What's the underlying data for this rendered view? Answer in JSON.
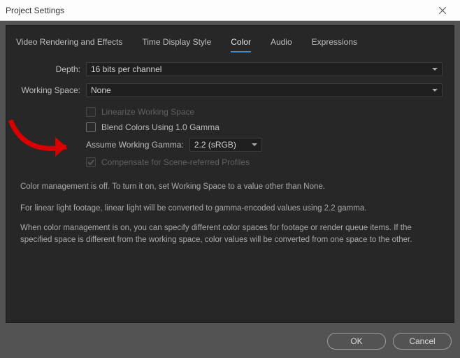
{
  "window": {
    "title": "Project Settings"
  },
  "tabs": [
    {
      "label": "Video Rendering and Effects",
      "active": false
    },
    {
      "label": "Time Display Style",
      "active": false
    },
    {
      "label": "Color",
      "active": true
    },
    {
      "label": "Audio",
      "active": false
    },
    {
      "label": "Expressions",
      "active": false
    }
  ],
  "fields": {
    "depth_label": "Depth:",
    "depth_value": "16 bits per channel",
    "workingspace_label": "Working Space:",
    "workingspace_value": "None",
    "linearize_label": "Linearize Working Space",
    "blend_label": "Blend Colors Using 1.0 Gamma",
    "assume_gamma_label": "Assume Working Gamma:",
    "assume_gamma_value": "2.2 (sRGB)",
    "compensate_label": "Compensate for Scene-referred Profiles"
  },
  "help": {
    "line1": "Color management is off. To turn it on, set Working Space to a value other than None.",
    "line2": "For linear light footage, linear light will be converted to gamma-encoded values using 2.2 gamma.",
    "block": "When color management is on, you can specify different color spaces for footage or render queue items. If the specified space is different from the working space, color values will be converted from one space to the other."
  },
  "buttons": {
    "ok": "OK",
    "cancel": "Cancel"
  }
}
